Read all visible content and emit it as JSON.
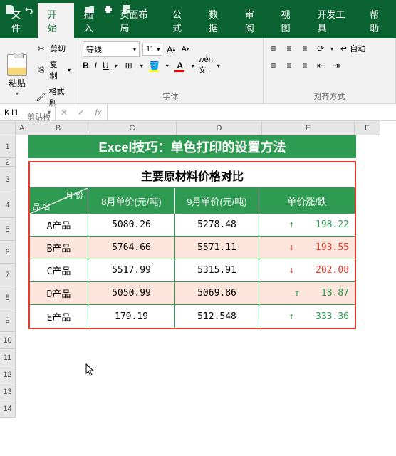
{
  "qat": {
    "save": "save-icon",
    "undo": "undo-icon",
    "redo": "redo-icon",
    "new": "new-icon",
    "open": "open-icon",
    "print": "print-icon",
    "preview": "preview-icon"
  },
  "tabs": [
    "文件",
    "开始",
    "插入",
    "页面布局",
    "公式",
    "数据",
    "审阅",
    "视图",
    "开发工具",
    "帮助"
  ],
  "active_tab": 1,
  "ribbon": {
    "clipboard": {
      "paste": "粘贴",
      "cut": "剪切",
      "copy": "复制",
      "format_painter": "格式刷",
      "group": "剪贴板"
    },
    "font": {
      "family": "等线",
      "size": "11",
      "group": "字体",
      "bold": "B",
      "italic": "I",
      "underline": "U"
    },
    "align": {
      "group": "对齐方式",
      "wrap": "自动"
    }
  },
  "formula_bar": {
    "name_box": "K11",
    "fx": "fx"
  },
  "cols": [
    "A",
    "B",
    "C",
    "D",
    "E",
    "F"
  ],
  "rows": [
    "1",
    "2",
    "3",
    "4",
    "5",
    "6",
    "7",
    "8",
    "9",
    "10",
    "11",
    "12",
    "13",
    "14"
  ],
  "banner": "Excel技巧：单色打印的设置方法",
  "table": {
    "title": "主要原材料价格对比",
    "header": {
      "month": "月 份",
      "product": "品  名",
      "aug": "8月单价(元/吨)",
      "sep": "9月单价(元/吨)",
      "diff": "单价涨/跌"
    },
    "rows": [
      {
        "name": "A产品",
        "aug": "5080.26",
        "sep": "5278.48",
        "dir": "up",
        "diff": "198.22",
        "alt": false
      },
      {
        "name": "B产品",
        "aug": "5764.66",
        "sep": "5571.11",
        "dir": "down",
        "diff": "193.55",
        "alt": true
      },
      {
        "name": "C产品",
        "aug": "5517.99",
        "sep": "5315.91",
        "dir": "down",
        "diff": "202.08",
        "alt": false
      },
      {
        "name": "D产品",
        "aug": "5050.99",
        "sep": "5069.86",
        "dir": "up",
        "diff": "18.87",
        "alt": true
      },
      {
        "name": "E产品",
        "aug": "179.19",
        "sep": "512.548",
        "dir": "up",
        "diff": "333.36",
        "alt": false
      }
    ]
  },
  "chart_data": {
    "type": "table",
    "title": "主要原材料价格对比",
    "columns": [
      "品名",
      "8月单价(元/吨)",
      "9月单价(元/吨)",
      "单价涨/跌"
    ],
    "rows": [
      [
        "A产品",
        5080.26,
        5278.48,
        198.22
      ],
      [
        "B产品",
        5764.66,
        5571.11,
        -193.55
      ],
      [
        "C产品",
        5517.99,
        5315.91,
        -202.08
      ],
      [
        "D产品",
        5050.99,
        5069.86,
        18.87
      ],
      [
        "E产品",
        179.19,
        512.548,
        333.36
      ]
    ]
  }
}
